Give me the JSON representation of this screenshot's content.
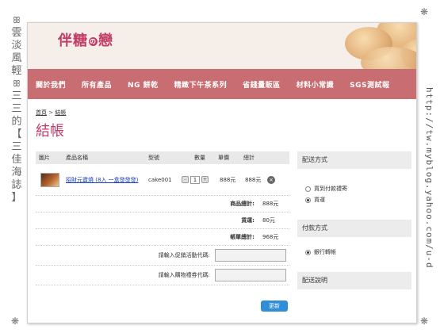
{
  "frame": {
    "left_text": [
      "雲",
      "淡",
      "風",
      "輕",
      "三",
      "三",
      "的",
      "【",
      "三",
      "佳",
      "海",
      "誌",
      "】"
    ],
    "right_text": "http://tw.myblog.yahoo.com/u-d"
  },
  "header": {
    "logo_part1": "伴糖",
    "logo_dot": "の",
    "logo_part2": "戀"
  },
  "nav": {
    "items": [
      "關於我們",
      "所有產品",
      "NG 餅乾",
      "精緻下午茶系列",
      "省錢量販區",
      "材料小常識",
      "SGS測試報"
    ]
  },
  "breadcrumb": {
    "home": "首頁",
    "separator": " > ",
    "current": "結帳"
  },
  "page_title": "結帳",
  "cart": {
    "headers": {
      "image": "圖片",
      "name": "產品名稱",
      "model": "型號",
      "qty": "數量",
      "price": "單價",
      "total": "總計"
    },
    "items": [
      {
        "name": "招財元寶燒 (8入 一盒發發發)",
        "model": "cake001",
        "qty": "1",
        "price": "888元",
        "total": "888元"
      }
    ],
    "qty_minus": "-",
    "qty_plus": "+",
    "remove": "×",
    "product_total_label": "商品總計:",
    "product_total": "888元",
    "shipping_label": "貨運:",
    "shipping": "80元",
    "grand_total_label": "帳單總計:",
    "grand_total": "968元",
    "promo_label": "請輸入促銷活動代碼:",
    "voucher_label": "請輸入購物禮券代碼:",
    "update_button": "更新"
  },
  "sidebar": {
    "shipping_title": "配送方式",
    "shipping_options": [
      {
        "label": "貨到付款禮寄",
        "selected": false
      },
      {
        "label": "貨運",
        "selected": true
      }
    ],
    "payment_title": "付款方式",
    "payment_options": [
      {
        "label": "銀行轉帳",
        "selected": true
      }
    ],
    "delivery_note_title": "配送說明"
  }
}
